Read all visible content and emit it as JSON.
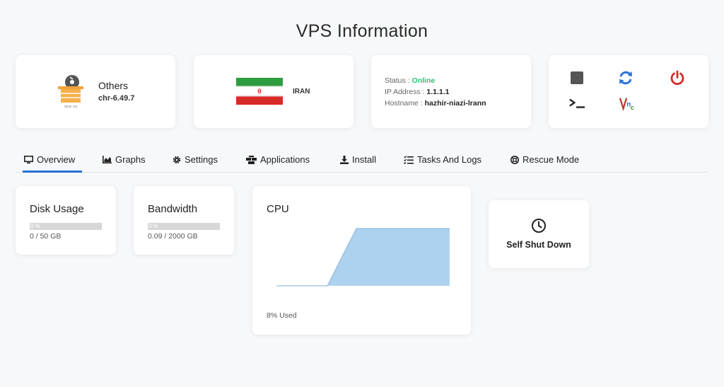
{
  "page": {
    "title": "VPS Information"
  },
  "os": {
    "name": "Others",
    "version": "chr-6.49.7",
    "logo_caption": "Other OS",
    "logo_icon": "os-box-icon"
  },
  "location": {
    "country": "IRAN",
    "flag_icon": "iran-flag-icon"
  },
  "server": {
    "status_label": "Status :",
    "status_value": "Online",
    "ip_label": "IP Address :",
    "ip_value": "1.1.1.1",
    "hostname_label": "Hostname :",
    "hostname_value": "hazhir-niazi-lrann"
  },
  "actions": [
    {
      "name": "stop",
      "icon": "stop-icon"
    },
    {
      "name": "restart",
      "icon": "refresh-icon"
    },
    {
      "name": "power",
      "icon": "power-icon"
    },
    {
      "name": "console",
      "icon": "terminal-icon"
    },
    {
      "name": "vnc",
      "icon": "vnc-icon"
    }
  ],
  "tabs": [
    {
      "label": "Overview",
      "icon": "monitor-icon",
      "active": true
    },
    {
      "label": "Graphs",
      "icon": "chart-icon"
    },
    {
      "label": "Settings",
      "icon": "gear-icon"
    },
    {
      "label": "Applications",
      "icon": "apps-icon"
    },
    {
      "label": "Install",
      "icon": "download-icon"
    },
    {
      "label": "Tasks And Logs",
      "icon": "tasks-icon"
    },
    {
      "label": "Rescue Mode",
      "icon": "lifebuoy-icon"
    }
  ],
  "disk": {
    "title": "Disk Usage",
    "percent_text": "0 %",
    "percent": 0,
    "value": "0 / 50 GB"
  },
  "bandwidth": {
    "title": "Bandwidth",
    "percent_text": "0 %",
    "percent": 0,
    "value": "0.09 / 2000 GB"
  },
  "cpu": {
    "title": "CPU",
    "used_text": "8% Used",
    "series": [
      0,
      0,
      0,
      0,
      100,
      100,
      100,
      100
    ],
    "fill_color": "#aed1ee",
    "line_color": "#8fbde3"
  },
  "shutdown": {
    "label": "Self Shut Down",
    "icon": "clock-icon"
  },
  "colors": {
    "accent": "#2b6fd6",
    "online": "#2ec07a",
    "refresh": "#2b73d8",
    "power": "#d42a2a"
  }
}
